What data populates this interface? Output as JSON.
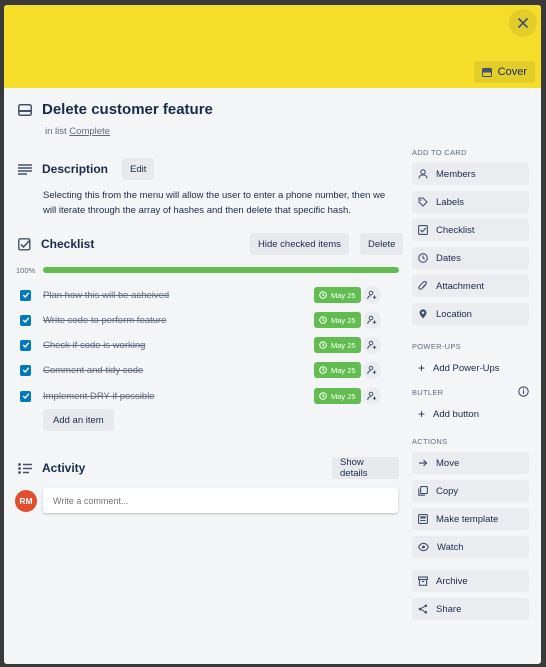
{
  "cover": {
    "color": "#f5dd29",
    "button_label": "Cover"
  },
  "card": {
    "title": "Delete customer feature",
    "in_list_prefix": "in list",
    "list_name": "Complete"
  },
  "description": {
    "heading": "Description",
    "edit_label": "Edit",
    "text": "Selecting this from the menu will allow the user to enter a phone number, then we will iterate through the array of hashes and then delete that specific hash."
  },
  "checklist": {
    "heading": "Checklist",
    "hide_label": "Hide checked items",
    "delete_label": "Delete",
    "progress_text": "100%",
    "progress_value": 1.0,
    "items": [
      {
        "text": "Plan how this will be acheived",
        "due": "May 25",
        "checked": true
      },
      {
        "text": "Write code to perform feature",
        "due": "May 25",
        "checked": true
      },
      {
        "text": "Check if code is working",
        "due": "May 25",
        "checked": true
      },
      {
        "text": "Comment and tidy code",
        "due": "May 25",
        "checked": true
      },
      {
        "text": "Implement DRY if possible",
        "due": "May 25",
        "checked": true
      }
    ],
    "add_item_label": "Add an item"
  },
  "activity": {
    "heading": "Activity",
    "show_details_label": "Show details",
    "avatar_initials": "RM",
    "comment_placeholder": "Write a comment..."
  },
  "sidebar": {
    "add_to_card": {
      "heading": "ADD TO CARD",
      "items": [
        {
          "label": "Members",
          "icon": "person-icon"
        },
        {
          "label": "Labels",
          "icon": "tag-icon"
        },
        {
          "label": "Checklist",
          "icon": "checklist-icon"
        },
        {
          "label": "Dates",
          "icon": "clock-icon"
        },
        {
          "label": "Attachment",
          "icon": "paperclip-icon"
        },
        {
          "label": "Location",
          "icon": "pin-icon"
        }
      ]
    },
    "power_ups": {
      "heading": "POWER-UPS",
      "add_label": "Add Power-Ups"
    },
    "butler": {
      "heading": "BUTLER",
      "add_label": "Add button"
    },
    "actions": {
      "heading": "ACTIONS",
      "items": [
        {
          "label": "Move",
          "icon": "arrow-right-icon"
        },
        {
          "label": "Copy",
          "icon": "copy-icon"
        },
        {
          "label": "Make template",
          "icon": "template-icon"
        },
        {
          "label": "Watch",
          "icon": "eye-icon"
        },
        {
          "label": "Archive",
          "icon": "archive-icon"
        },
        {
          "label": "Share",
          "icon": "share-icon"
        }
      ]
    }
  },
  "colors": {
    "accent_blue": "#0079bf",
    "success_green": "#61bd4f",
    "avatar_red": "#e04e2d"
  }
}
